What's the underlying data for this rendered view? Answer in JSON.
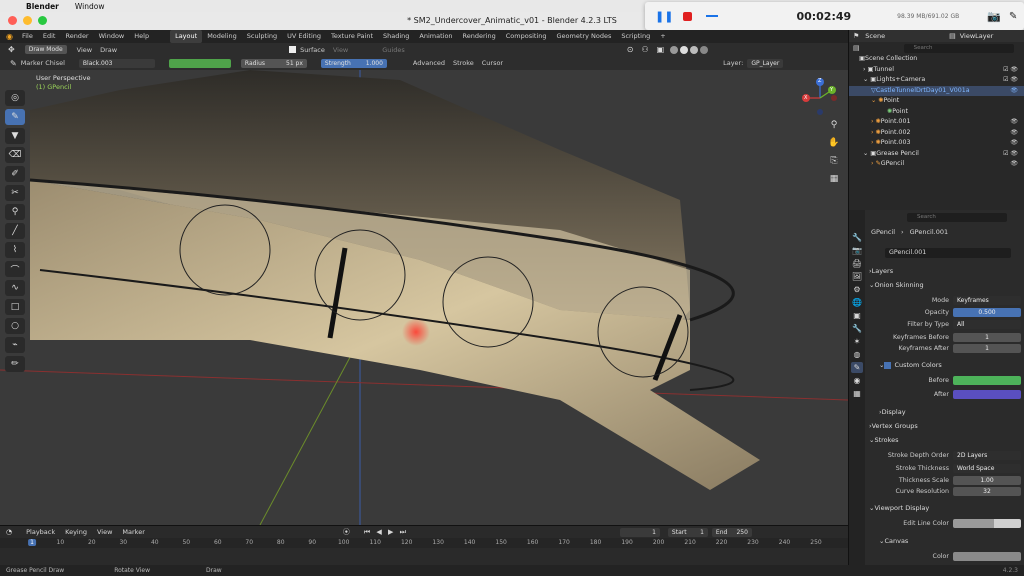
{
  "mac_menu": {
    "app": "Blender",
    "window": "Window"
  },
  "window_title": "* SM2_Undercover_Animatic_v01 - Blender 4.2.3 LTS",
  "recorder": {
    "time": "00:02:49",
    "storage": "98.39 MB/691.02 GB"
  },
  "menu": {
    "items": [
      "File",
      "Edit",
      "Render",
      "Window",
      "Help"
    ],
    "workspaces": [
      "Layout",
      "Modeling",
      "Sculpting",
      "UV Editing",
      "Texture Paint",
      "Shading",
      "Animation",
      "Rendering",
      "Compositing",
      "Geometry Nodes",
      "Scripting"
    ],
    "active_workspace": "Layout",
    "add": "+"
  },
  "toolbar1": {
    "mode": "Draw Mode",
    "view": "View",
    "draw": "Draw",
    "surface": "Surface",
    "view2": "View",
    "guides": "Guides"
  },
  "toolbar2": {
    "brush": "Marker Chisel",
    "material": "Black.003",
    "color": "#4fa34a",
    "radius_label": "Radius",
    "radius_value": "51 px",
    "strength_label": "Strength",
    "strength_value": "1.000",
    "advanced": "Advanced",
    "stroke": "Stroke",
    "cursor": "Cursor",
    "layer_label": "Layer:",
    "layer_value": "GP_Layer"
  },
  "viewport": {
    "perspective": "User Perspective",
    "object": "(1) GPencil"
  },
  "gizmo": {
    "x": "X",
    "y": "Y",
    "z": "Z"
  },
  "outliner": {
    "scene_label": "Scene",
    "view_layer": "ViewLayer",
    "search_placeholder": "Search",
    "items": [
      {
        "label": "Scene Collection"
      },
      {
        "label": "Tunnel"
      },
      {
        "label": "Lights+Camera"
      },
      {
        "label": "CastleTunnelDrtDay01_V001a"
      },
      {
        "label": "Point"
      },
      {
        "label": "Point"
      },
      {
        "label": "Point.001"
      },
      {
        "label": "Point.002"
      },
      {
        "label": "Point.003"
      },
      {
        "label": "Grease Pencil"
      },
      {
        "label": "GPencil"
      }
    ]
  },
  "properties": {
    "search_placeholder": "Search",
    "breadcrumb": [
      "GPencil",
      "GPencil.001"
    ],
    "datablock": "GPencil.001",
    "sections": {
      "layers": "Layers",
      "onion": "Onion Skinning",
      "display": "Display",
      "vertex_groups": "Vertex Groups",
      "strokes": "Strokes",
      "viewport_display": "Viewport Display",
      "canvas": "Canvas"
    },
    "onion": {
      "mode_label": "Mode",
      "mode_value": "Keyframes",
      "opacity_label": "Opacity",
      "opacity_value": "0.500",
      "filter_label": "Filter by Type",
      "filter_value": "All",
      "before_label": "Keyframes Before",
      "before_value": "1",
      "after_label": "Keyframes After",
      "after_value": "1",
      "custom_colors": "Custom Colors",
      "before_color_label": "Before",
      "after_color_label": "After",
      "before_color": "#4db35a",
      "after_color": "#5a4fc0"
    },
    "strokes": {
      "depth_label": "Stroke Depth Order",
      "depth_value": "2D Layers",
      "thickness_label": "Stroke Thickness",
      "thickness_value": "World Space",
      "scale_label": "Thickness Scale",
      "scale_value": "1.00",
      "curve_label": "Curve Resolution",
      "curve_value": "32"
    },
    "viewport_display": {
      "edit_line_label": "Edit Line Color",
      "canvas_color_label": "Color"
    }
  },
  "timeline": {
    "playback": "Playback",
    "keying": "Keying",
    "view": "View",
    "marker": "Marker",
    "current_frame": "1",
    "start_label": "Start",
    "start": "1",
    "end_label": "End",
    "end": "250",
    "ticks": [
      "1",
      "10",
      "20",
      "30",
      "40",
      "50",
      "60",
      "70",
      "80",
      "90",
      "100",
      "110",
      "120",
      "130",
      "140",
      "150",
      "160",
      "170",
      "180",
      "190",
      "200",
      "210",
      "220",
      "230",
      "240",
      "250"
    ]
  },
  "status": {
    "left": "Grease Pencil Draw",
    "mid": "Rotate View",
    "right": "Draw",
    "version": "4.2.3"
  }
}
